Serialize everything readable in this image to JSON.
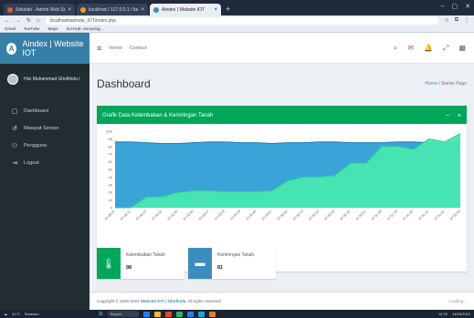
{
  "browser": {
    "tabs": [
      {
        "title": "Sekolah - Admin Web Sekolah",
        "active": false
      },
      {
        "title": "localhost / 127.0.0.1 / belajar",
        "active": false
      },
      {
        "title": "Aindex | Website IOT",
        "active": true
      }
    ],
    "url": "localhost/website_IOT/index.php",
    "bookmarks": [
      "Gmail",
      "YouTube",
      "Maps",
      "Sci-Hub: removing..."
    ]
  },
  "app": {
    "brand": "Aindex | Website IOT",
    "brand_initial": "A",
    "user_name": "Hisi Muhammad Gholfinda I",
    "menu": [
      {
        "label": "Dashboard",
        "icon": "dashboard-icon",
        "glyph": "▢"
      },
      {
        "label": "Riwayat Sensor",
        "icon": "history-icon",
        "glyph": "↺"
      },
      {
        "label": "Pengguna",
        "icon": "users-icon",
        "glyph": "⚇"
      },
      {
        "label": "Logout",
        "icon": "logout-icon",
        "glyph": "⇥"
      }
    ],
    "topnav": {
      "home": "Home",
      "contact": "Contact"
    }
  },
  "page": {
    "title": "Dashboard",
    "crumb_home": "Home",
    "crumb_sep": " / ",
    "crumb_current": "Starter Page"
  },
  "chart_card": {
    "title": "Grafik Data Kelembaban & Kemiringan Tanah",
    "collapse": "−",
    "close": "×"
  },
  "chart_data": {
    "type": "area",
    "ylim": [
      0,
      100
    ],
    "y_ticks": [
      0,
      10,
      20,
      30,
      40,
      50,
      60,
      70,
      80,
      90,
      100
    ],
    "x": [
      "07:48:01",
      "07:48:12",
      "07:48:23",
      "07:48:34",
      "07:48:45",
      "07:48:56",
      "07:49:07",
      "07:49:18",
      "07:49:29",
      "07:49:40",
      "07:49:51",
      "07:50:02",
      "07:50:13",
      "07:50:24",
      "07:50:35",
      "07:50:46",
      "07:50:57",
      "07:51:08",
      "07:51:19",
      "07:51:30",
      "07:51:41",
      "07:51:52",
      "07:52:03"
    ],
    "series": [
      {
        "values": [
          86,
          86,
          85,
          84,
          84,
          85,
          86,
          86,
          85,
          85,
          84,
          85,
          85,
          86,
          86,
          85,
          85,
          85,
          86,
          86,
          85,
          85,
          85
        ],
        "color": "#3aa3d8"
      },
      {
        "values": [
          0,
          0,
          14,
          14,
          20,
          22,
          22,
          21,
          21,
          21,
          22,
          35,
          40,
          40,
          42,
          58,
          58,
          80,
          80,
          76,
          90,
          86,
          97
        ],
        "color": "#47e8b0"
      }
    ]
  },
  "info_boxes": [
    {
      "label": "Kelembaban Tanah",
      "value": "98",
      "color": "#00a65a",
      "icon": "thermometer-icon",
      "glyph": "🌡"
    },
    {
      "label": "Kemiringan Tanah",
      "value": "81",
      "color": "#3c8dbc",
      "icon": "level-icon",
      "glyph": "▬"
    }
  ],
  "footer": {
    "copyright": "Copyright © 2000-2022",
    "link": "Website IOT",
    "author": "Ghofinda",
    "rights": ". All rights reserved.",
    "version": "Loading..."
  },
  "taskbar": {
    "weather_temp": "31°C",
    "weather_desc": "Berawan",
    "search": "Search",
    "time": "10.20",
    "date": "14/05/2022"
  }
}
